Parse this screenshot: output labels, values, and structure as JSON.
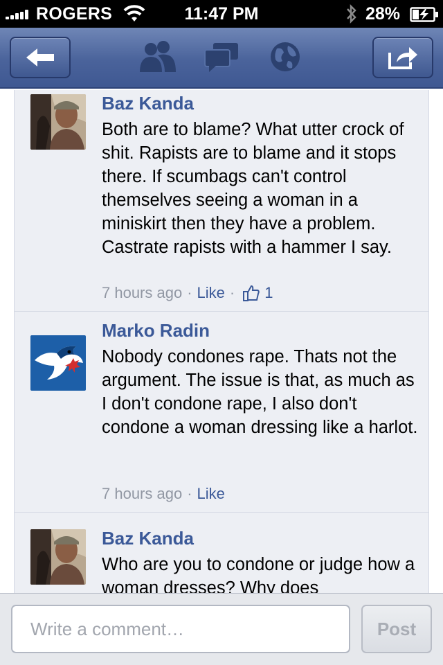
{
  "status_bar": {
    "carrier": "ROGERS",
    "time": "11:47 PM",
    "battery": "28%"
  },
  "nav": {
    "icons": [
      "back-arrow-icon",
      "friends-icon",
      "messages-icon",
      "globe-icon",
      "share-icon"
    ]
  },
  "comments": [
    {
      "author": "Baz Kanda",
      "text": "Both are to blame? What utter crock of shit. Rapists are to blame and it stops there. If scumbags can't control themselves seeing a woman in a miniskirt then they have a problem. Castrate rapists with a hammer I say.",
      "time": "7 hours ago",
      "like_label": "Like",
      "like_count": "1"
    },
    {
      "author": "Marko Radin",
      "text": "Nobody condones rape. Thats not the argument. The issue is that, as much as I don't condone rape, I also don't condone a woman dressing like a harlot.",
      "time": "7 hours ago",
      "like_label": "Like"
    },
    {
      "author": "Baz Kanda",
      "text": "Who are you to condone or judge how a woman dresses? Why does"
    }
  ],
  "composer": {
    "placeholder": "Write a comment…",
    "post_label": "Post"
  },
  "colors": {
    "nav_blue": "#4a639b",
    "link_blue": "#3b5998",
    "content_bg": "#edeff4",
    "meta_gray": "#9197a3"
  }
}
